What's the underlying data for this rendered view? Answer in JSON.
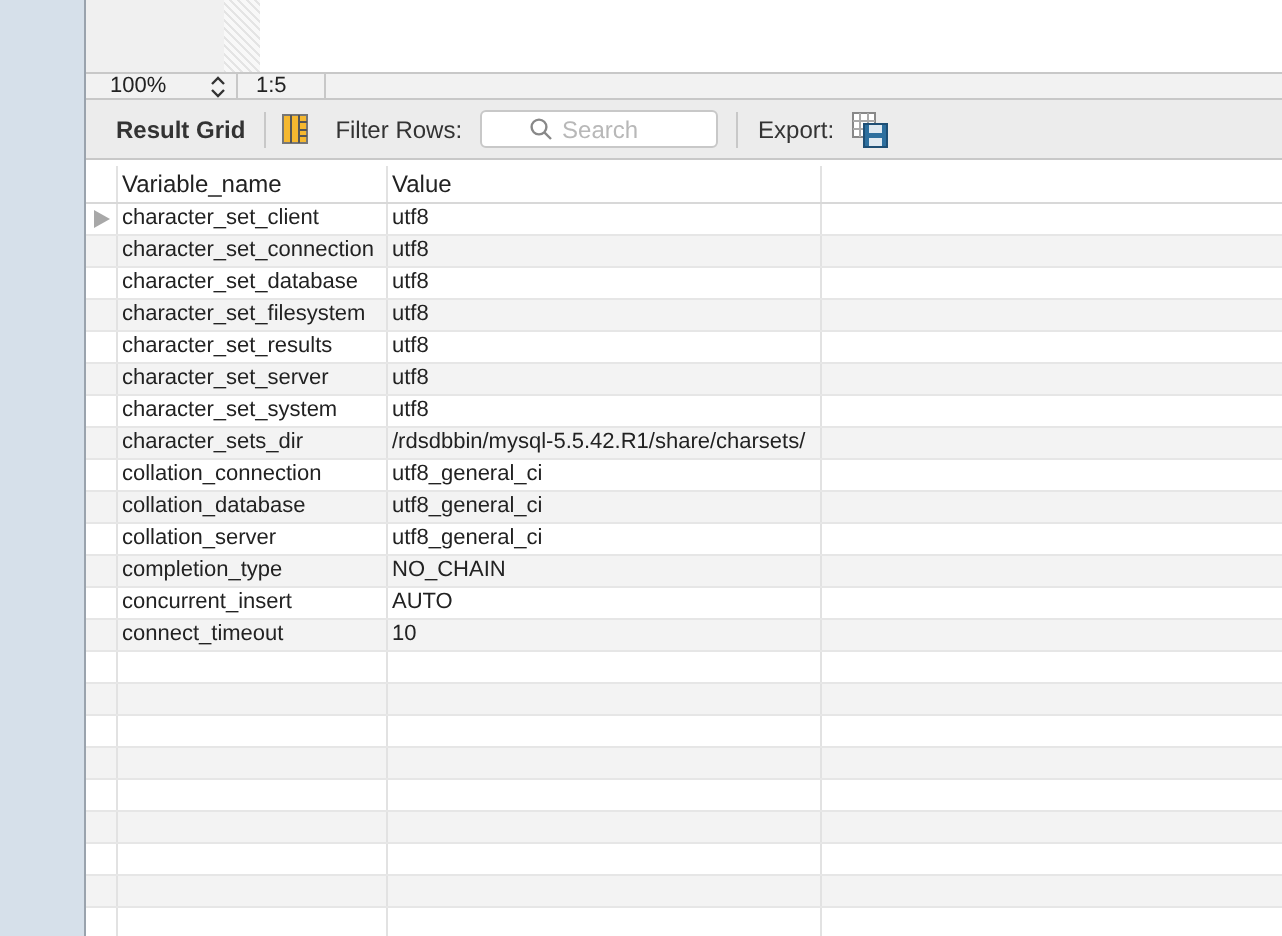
{
  "status_bar": {
    "zoom": "100%",
    "position": "1:5"
  },
  "toolbar": {
    "result_grid": "Result Grid",
    "filter_label": "Filter Rows:",
    "search_placeholder": "Search",
    "export_label": "Export:"
  },
  "table": {
    "columns": [
      "Variable_name",
      "Value"
    ],
    "rows": [
      {
        "name": "character_set_client",
        "value": "utf8",
        "current": true
      },
      {
        "name": "character_set_connection",
        "value": "utf8",
        "current": false
      },
      {
        "name": "character_set_database",
        "value": "utf8",
        "current": false
      },
      {
        "name": "character_set_filesystem",
        "value": "utf8",
        "current": false
      },
      {
        "name": "character_set_results",
        "value": "utf8",
        "current": false
      },
      {
        "name": "character_set_server",
        "value": "utf8",
        "current": false
      },
      {
        "name": "character_set_system",
        "value": "utf8",
        "current": false
      },
      {
        "name": "character_sets_dir",
        "value": "/rdsdbbin/mysql-5.5.42.R1/share/charsets/",
        "current": false
      },
      {
        "name": "collation_connection",
        "value": "utf8_general_ci",
        "current": false
      },
      {
        "name": "collation_database",
        "value": "utf8_general_ci",
        "current": false
      },
      {
        "name": "collation_server",
        "value": "utf8_general_ci",
        "current": false
      },
      {
        "name": "completion_type",
        "value": "NO_CHAIN",
        "current": false
      },
      {
        "name": "concurrent_insert",
        "value": "AUTO",
        "current": false
      },
      {
        "name": "connect_timeout",
        "value": "10",
        "current": false
      }
    ]
  }
}
